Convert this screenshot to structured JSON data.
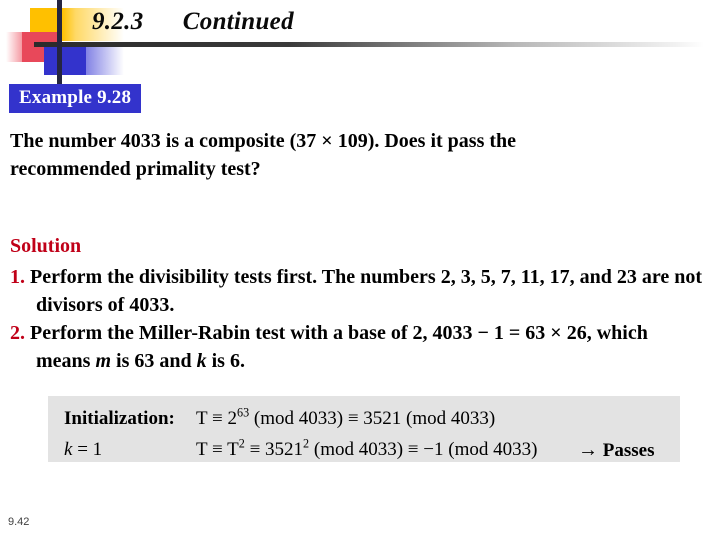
{
  "slide": {
    "title": "9.2.3      Continued",
    "footer_number": "9.42"
  },
  "example_badge": {
    "label": "Example 9.28"
  },
  "body": {
    "paragraph_line1": "The  number  4033  is  a  composite  (37  ×  109).  Does  it  pass  the",
    "paragraph_line2": "recommended primality test?"
  },
  "solution": {
    "heading": "Solution",
    "items": [
      {
        "number": "1.",
        "text": "Perform the divisibility tests first. The numbers 2, 3, 5, 7, 11, 17, and 23 are not divisors of 4033."
      },
      {
        "number": "2.",
        "text_part1": "Perform the Miller-Rabin test with a base of 2, 4033 − 1 = 63 × 26, which means ",
        "italic1": "m",
        "text_part2": " is 63 and ",
        "italic2": "k",
        "text_part3": " is 6."
      }
    ]
  },
  "math_box": {
    "init_label": "Initialization:",
    "init_expr_pre": "T ≡ 2",
    "init_expr_exp": "63",
    "init_expr_post": " (mod 4033) ≡ 3521 (mod 4033)",
    "k_label_var": "k",
    "k_label_rest": " = 1",
    "row2_pre": "T ≡ T",
    "row2_exp1": "2",
    "row2_mid": " ≡ 3521",
    "row2_exp2": "2",
    "row2_post": " (mod 4033) ≡ −1 (mod 4033)",
    "arrow": "→",
    "result": "Passes"
  },
  "colors": {
    "accent_blue": "#3333CC",
    "accent_yellow": "#FFC000",
    "accent_red": "#E8485A",
    "solution_red": "#C00018",
    "math_box_bg": "#E3E3E3"
  }
}
